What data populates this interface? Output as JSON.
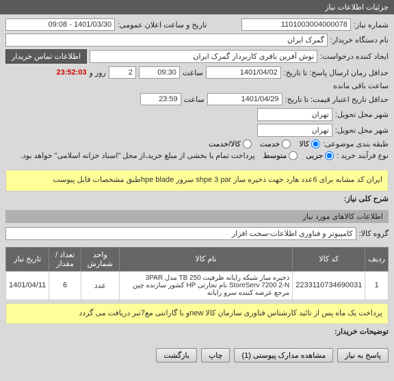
{
  "header": {
    "title": "جزئیات اطلاعات نیاز"
  },
  "fields": {
    "need_no_label": "شماره نیاز:",
    "need_no": "1101003004000078",
    "announce_label": "تاریخ و ساعت اعلان عمومی:",
    "announce_value": "1401/03/30 - 09:08",
    "buyer_label": "نام دستگاه خریدار:",
    "buyer": "گمرک ایران",
    "requester_label": "ایجاد کننده درخواست:",
    "requester": "نوش آفرین باقری کاربردار گمرک ایران",
    "contact_btn": "اطلاعات تماس خریدار",
    "deadline_label": "حداقل زمان ارسال پاسخ: تا تاریخ:",
    "deadline_date": "1401/04/02",
    "time_label": "ساعت",
    "deadline_time": "09:30",
    "days_label": "روز و",
    "days": "2",
    "countdown": "23:52:03",
    "remaining": "ساعت باقی مانده",
    "validity_label": "حداقل تاریخ اعتبار قیمت: تا تاریخ:",
    "validity_date": "1401/04/29",
    "validity_time": "23:59",
    "city_deliver_label": "شهر محل تحویل:",
    "city_deliver": "تهران",
    "city_load_label": "شهر محل تحویل:",
    "city_load": "تهران",
    "category_label": "طبقه بندی موضوعی:",
    "cat_goods": "کالا",
    "cat_service": "خدمت",
    "cat_both": "کالا/خدمت",
    "process_label": "نوع فرآیند خرید :",
    "proc_partial": "جزیی",
    "proc_medium": "متوسط",
    "payment_note": "پرداخت تمام یا بخشی از مبلغ خرید،از محل \"اسناد خزانه اسلامی\" خواهد بود.",
    "desc_label": "شرح کلی نیاز:",
    "desc_text": "ایران کد مشابه برای 6عدد هارد جهت ذخیره ساز shpe 3 par سرور hpe bladeطبق مشخصات فایل پیوست",
    "items_header": "اطلاعات کالاهای مورد نیاز",
    "group_label": "گروه کالا:",
    "group_value": "کامپیوتر و فناوری اطلاعات-سخت افزار",
    "notes_label": "توضیحات خریدار:",
    "notes_text": "پرداخت یک ماه پس از تائید کارشناس فناوری سازمان کالا newو با گارانتی مع7تبر دریافت می گردد"
  },
  "table": {
    "headers": {
      "row": "ردیف",
      "code": "کد کالا",
      "name": "نام کالا",
      "unit": "واحد شمارش",
      "qty": "تعداد / مقدار",
      "date": "تاریخ نیاز"
    },
    "rows": [
      {
        "row": "1",
        "code": "2233110734690031",
        "name": "ذخیره ساز شبکه رایانه ظرفیت TB 250 مدل 3PAR StoreServ 7200 2-N نام تجارتی HP کشور سازنده چین مرجع عرضه کننده سرو رایانه",
        "unit": "عدد",
        "qty": "6",
        "date": "1401/04/11"
      }
    ]
  },
  "footer": {
    "reply": "پاسخ به نیاز",
    "attachments": "مشاهده مدارک پیوستی (1)",
    "print": "چاپ",
    "back": "بازگشت"
  }
}
